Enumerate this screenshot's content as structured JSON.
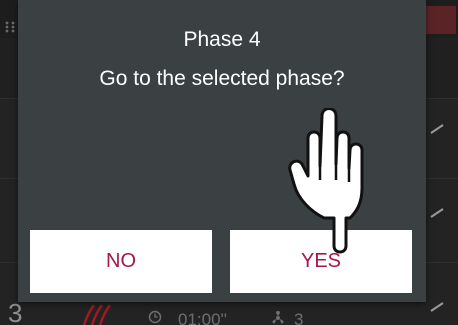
{
  "dialog": {
    "title": "Phase 4",
    "message": "Go to the selected phase?",
    "no_label": "NO",
    "yes_label": "YES"
  },
  "background": {
    "phase_number": "3",
    "time": "01:00''",
    "fan_level": "3",
    "icons": [
      "grip-icon",
      "heat-icon",
      "clock-icon",
      "fan-icon",
      "edit-icon"
    ]
  },
  "colors": {
    "dialog_bg": "#3b4042",
    "button_bg": "#ffffff",
    "button_text": "#a3174a",
    "heat_accent": "#9e1b22",
    "topbar_accent": "#5a2426"
  },
  "overlay": {
    "pointer_icon": "tap-hand-icon"
  }
}
